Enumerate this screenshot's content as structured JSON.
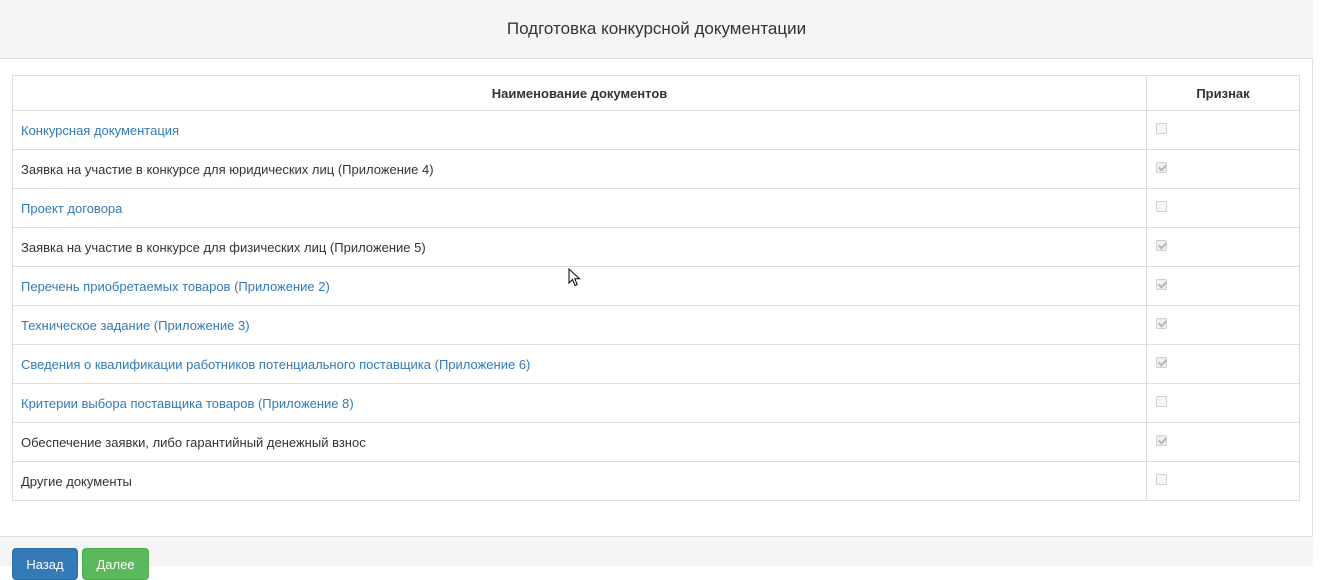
{
  "header": {
    "title": "Подготовка конкурсной документации"
  },
  "table": {
    "columns": [
      "Наименование документов",
      "Признак"
    ],
    "rows": [
      {
        "name": "Конкурсная документация",
        "is_link": true,
        "checked": false
      },
      {
        "name": "Заявка на участие в конкурсе для юридических лиц (Приложение 4)",
        "is_link": false,
        "checked": true
      },
      {
        "name": "Проект договора",
        "is_link": true,
        "checked": false
      },
      {
        "name": "Заявка на участие в конкурсе для физических лиц (Приложение 5)",
        "is_link": false,
        "checked": true
      },
      {
        "name": "Перечень приобретаемых товаров (Приложение 2)",
        "is_link": true,
        "checked": true
      },
      {
        "name": "Техническое задание (Приложение 3)",
        "is_link": true,
        "checked": true
      },
      {
        "name": "Сведения о квалификации работников потенциального поставщика (Приложение 6)",
        "is_link": true,
        "checked": true
      },
      {
        "name": "Критерии выбора поставщика товаров (Приложение 8)",
        "is_link": true,
        "checked": false
      },
      {
        "name": "Обеспечение заявки, либо гарантийный денежный взнос",
        "is_link": false,
        "checked": true
      },
      {
        "name": "Другие документы",
        "is_link": false,
        "checked": false
      }
    ]
  },
  "footer": {
    "back_label": "Назад",
    "next_label": "Далее"
  },
  "colors": {
    "link": "#337ab7",
    "primary": "#337ab7",
    "success": "#5cb85c"
  }
}
